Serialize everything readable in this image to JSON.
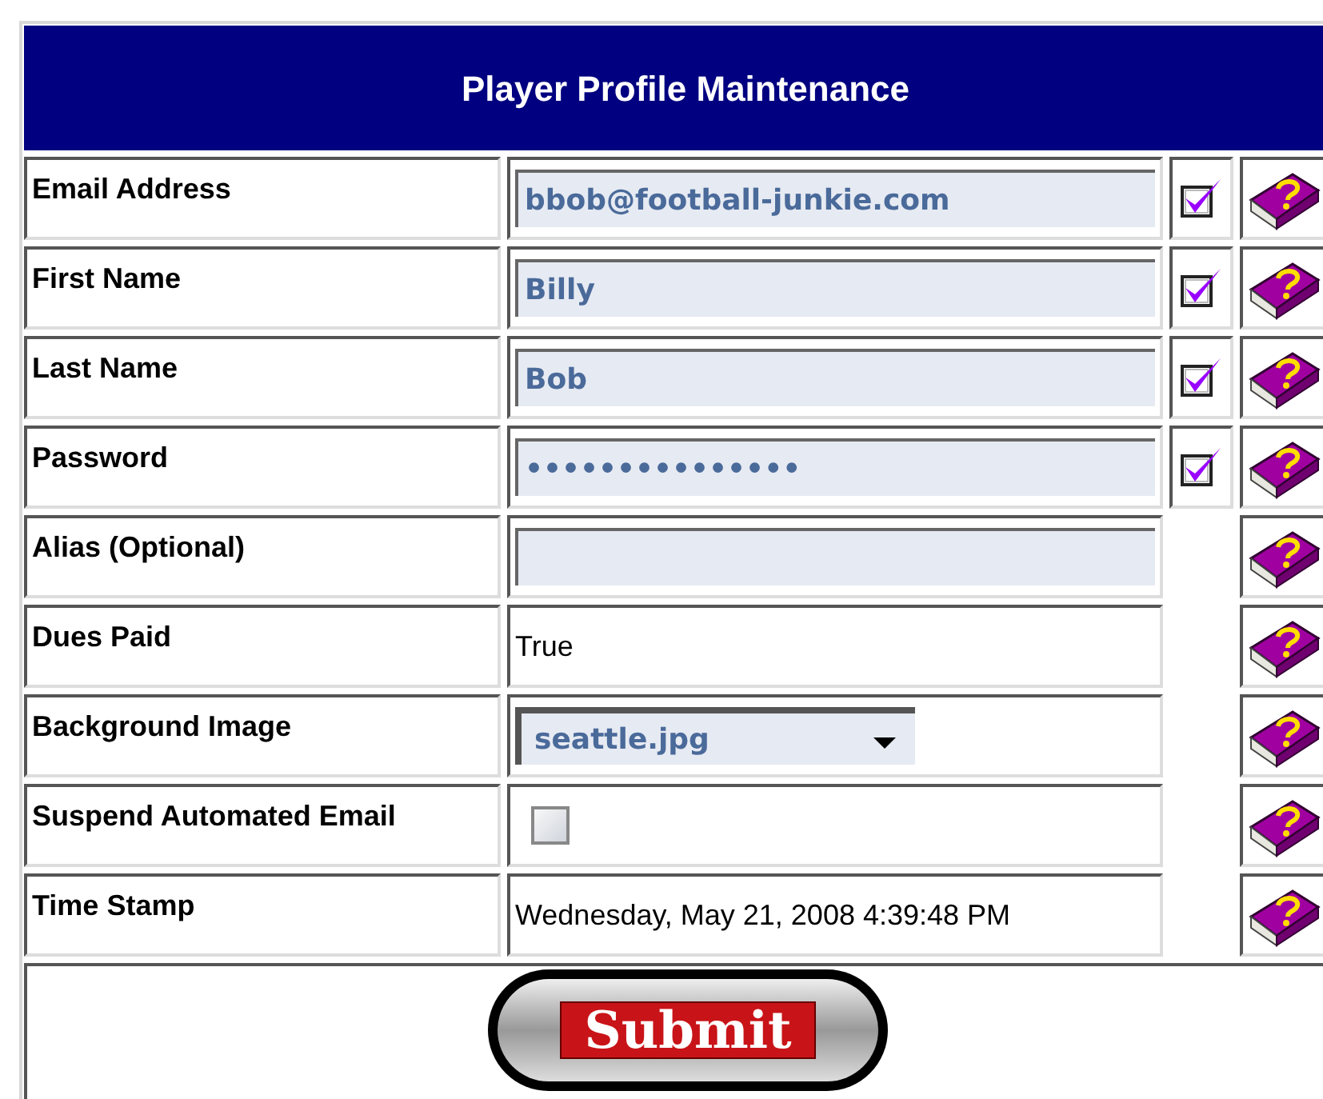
{
  "title": "Player Profile Maintenance",
  "fields": [
    {
      "label": "Email Address",
      "kind": "input",
      "value": "bbob@football-junkie.com",
      "required": true
    },
    {
      "label": "First Name",
      "kind": "input",
      "value": "Billy",
      "required": true
    },
    {
      "label": "Last Name",
      "kind": "input",
      "value": "Bob",
      "required": true
    },
    {
      "label": "Password",
      "kind": "input",
      "value": "•••••••••••••••",
      "required": true
    },
    {
      "label": "Alias (Optional)",
      "kind": "input",
      "required": false
    },
    {
      "label": "Dues Paid",
      "kind": "text",
      "value": "True",
      "required": false
    },
    {
      "label": "Background Image",
      "kind": "select",
      "value": "seattle.jpg",
      "required": false
    },
    {
      "label": "Suspend Automated Email",
      "kind": "checkbox",
      "checked": false,
      "required": false
    },
    {
      "label": "Time Stamp",
      "kind": "text",
      "value": "Wednesday, May 21, 2008 4:39:48 PM",
      "required": false
    }
  ],
  "submit": "Submit"
}
